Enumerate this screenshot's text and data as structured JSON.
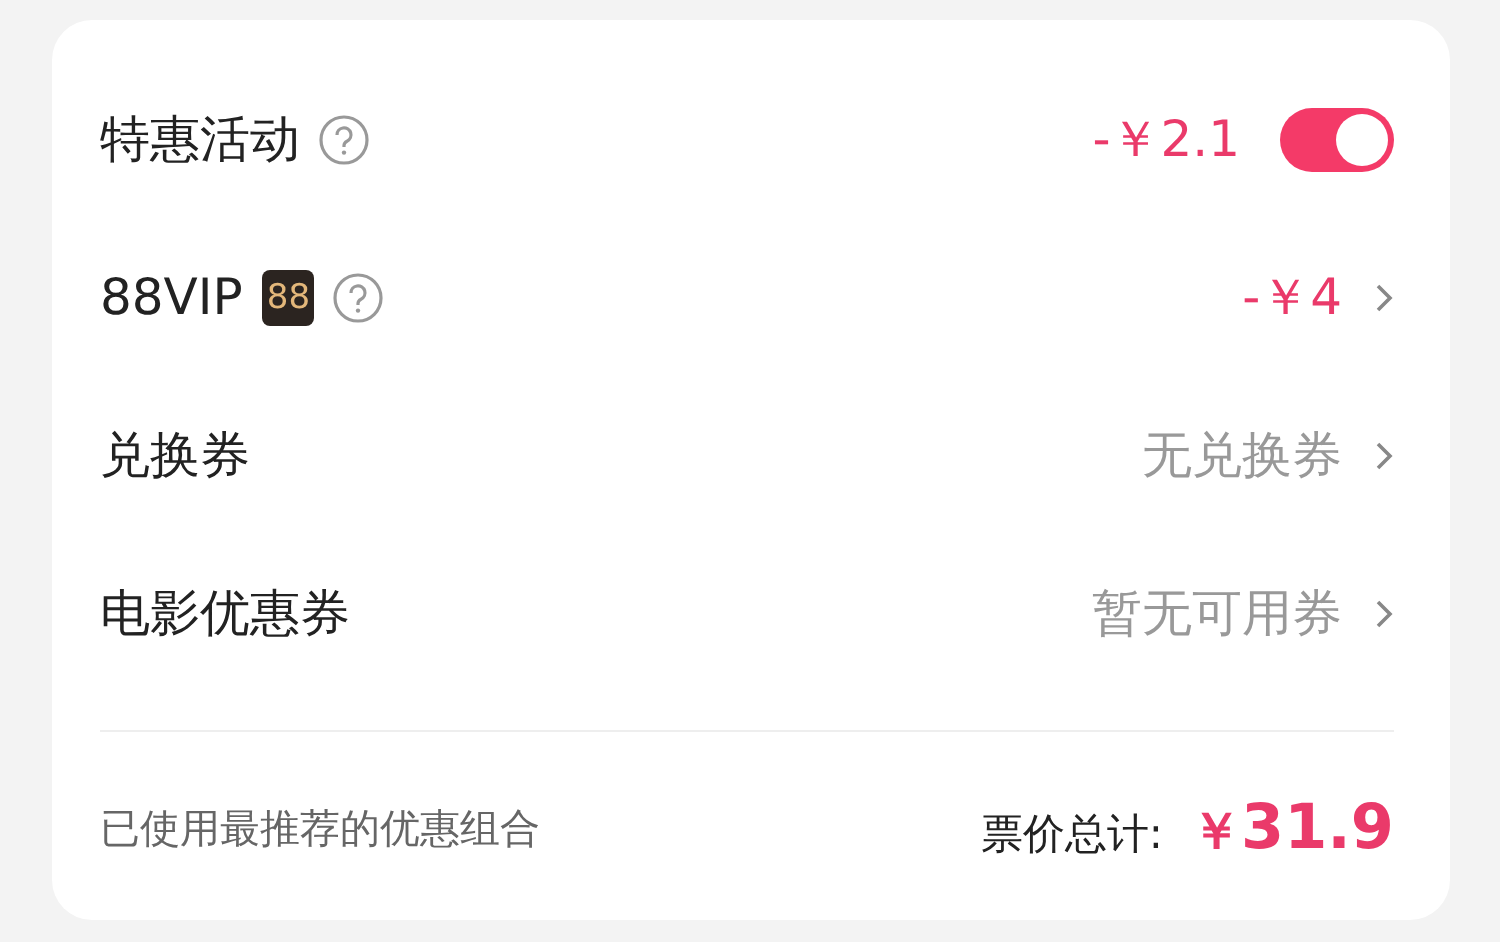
{
  "rows": [
    {
      "kind": "toggle",
      "label": "特惠活动",
      "help": true,
      "value": "-￥2.1",
      "highlight": true,
      "on": true
    },
    {
      "kind": "link",
      "label": "88VIP",
      "badge": "88",
      "help": true,
      "value": "-￥4",
      "highlight": true
    },
    {
      "kind": "link",
      "label": "兑换券",
      "help": false,
      "value": "无兑换券",
      "highlight": false
    },
    {
      "kind": "link",
      "label": "电影优惠券",
      "help": false,
      "value": "暂无可用券",
      "highlight": false
    }
  ],
  "footer": {
    "note": "已使用最推荐的优惠组合",
    "total_label": "票价总计:",
    "currency": "￥",
    "amount": "31.9"
  }
}
